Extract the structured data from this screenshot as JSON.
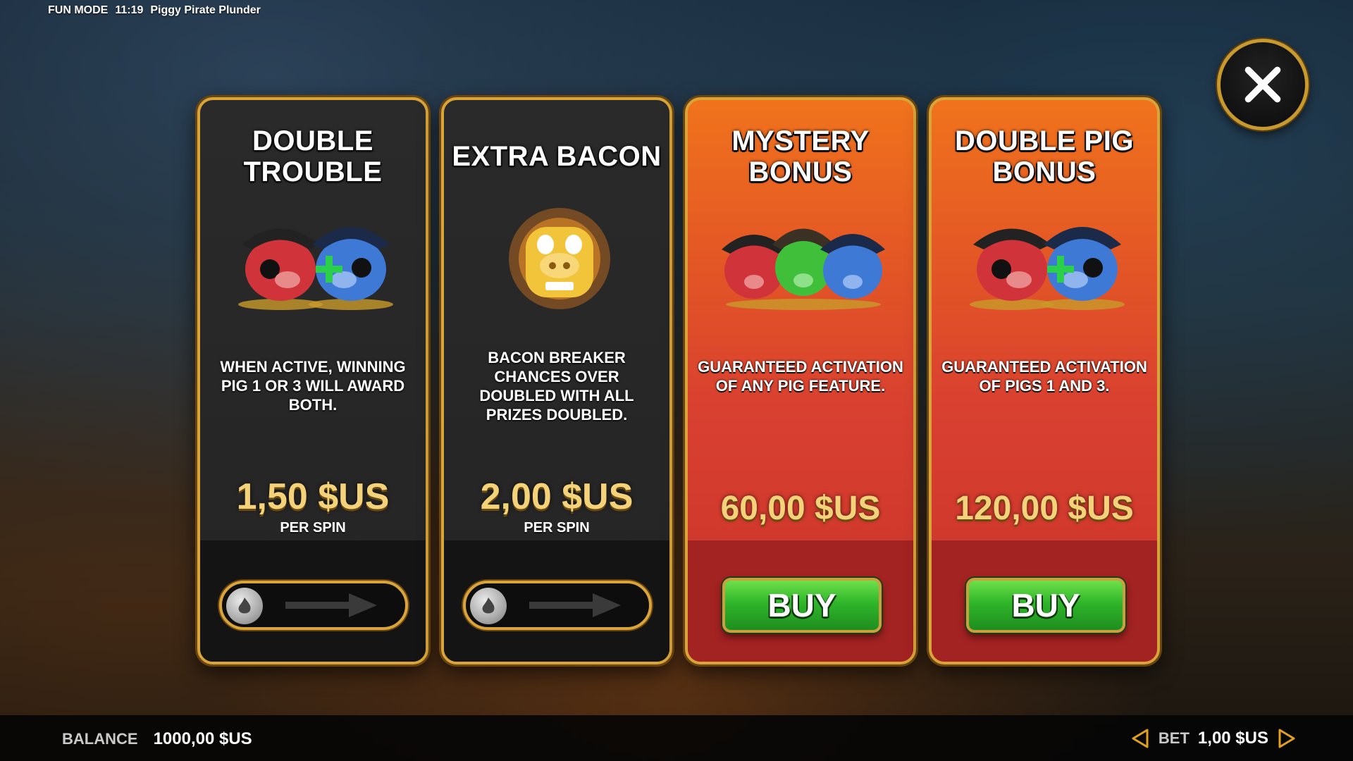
{
  "header": {
    "mode": "FUN MODE",
    "time": "11:19",
    "game_title": "Piggy Pirate Plunder"
  },
  "cards": [
    {
      "title_line1": "DOUBLE",
      "title_line2": "TROUBLE",
      "art": "two-pirate-pigs-red-blue",
      "description": "WHEN ACTIVE, WINNING PIG 1 OR 3 WILL AWARD BOTH.",
      "price": "1,50 $US",
      "price_sub": "PER SPIN",
      "control": "toggle",
      "toggle_state": "off"
    },
    {
      "title": "EXTRA BACON",
      "art": "golden-pig-fire",
      "description": "BACON BREAKER CHANCES OVER DOUBLED WITH ALL PRIZES DOUBLED.",
      "price": "2,00 $US",
      "price_sub": "PER SPIN",
      "control": "toggle",
      "toggle_state": "off"
    },
    {
      "title_line1": "MYSTERY",
      "title_line2": "BONUS",
      "art": "three-pirate-pigs",
      "description": "GUARANTEED ACTIVATION OF ANY PIG FEATURE.",
      "price": "60,00 $US",
      "control": "button",
      "button_label": "BUY"
    },
    {
      "title_line1": "DOUBLE PIG",
      "title_line2": "BONUS",
      "art": "two-pirate-pigs-red-blue",
      "description": "GUARANTEED ACTIVATION OF PIGS 1 AND 3.",
      "price": "120,00 $US",
      "control": "button",
      "button_label": "BUY"
    }
  ],
  "footer": {
    "balance_label": "BALANCE",
    "balance_value": "1000,00 $US",
    "bet_label": "BET",
    "bet_value": "1,00 $US"
  },
  "colors": {
    "gold_border": "#d9a53a",
    "dark_card": "#2a2a2a",
    "red_card": "#d94030",
    "buy_green": "#2fb52a",
    "price_gold": "#f3d27a"
  },
  "icons": {
    "close": "close-icon",
    "bet_decrease": "triangle-left-icon",
    "bet_increase": "triangle-right-icon",
    "toggle_arrow": "arrow-right-icon"
  }
}
